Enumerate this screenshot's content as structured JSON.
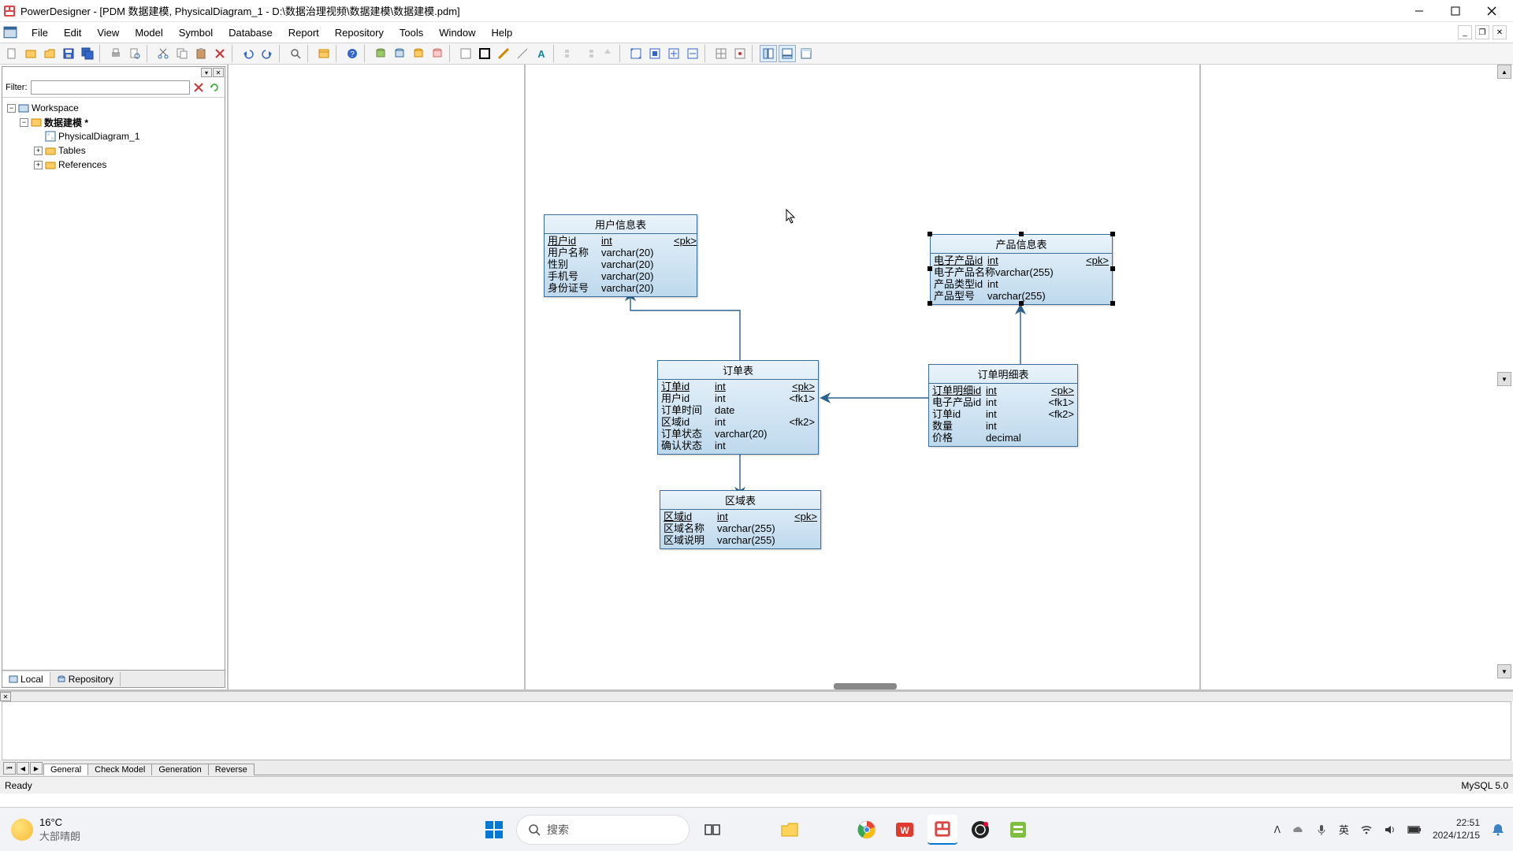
{
  "title": "PowerDesigner - [PDM 数据建模, PhysicalDiagram_1 - D:\\数据治理视频\\数据建模\\数据建模.pdm]",
  "menu": [
    "File",
    "Edit",
    "View",
    "Model",
    "Symbol",
    "Database",
    "Report",
    "Repository",
    "Tools",
    "Window",
    "Help"
  ],
  "sidebar": {
    "filter_label": "Filter:",
    "filter_value": "",
    "tree": {
      "root": "Workspace",
      "model": "数据建模 *",
      "diagram": "PhysicalDiagram_1",
      "tables": "Tables",
      "references": "References"
    },
    "tabs": [
      "Local",
      "Repository"
    ]
  },
  "entities": {
    "user": {
      "title": "用户信息表",
      "cols": [
        {
          "n": "用户id",
          "t": "int",
          "k": "<pk>",
          "u": true
        },
        {
          "n": "用户名称",
          "t": "varchar(20)",
          "k": ""
        },
        {
          "n": "性别",
          "t": "varchar(20)",
          "k": ""
        },
        {
          "n": "手机号",
          "t": "varchar(20)",
          "k": ""
        },
        {
          "n": "身份证号",
          "t": "varchar(20)",
          "k": ""
        }
      ]
    },
    "product": {
      "title": "产品信息表",
      "cols": [
        {
          "n": "电子产品id",
          "t": "int",
          "k": "<pk>",
          "u": true
        },
        {
          "n": "电子产品名称",
          "t": "varchar(255)",
          "k": ""
        },
        {
          "n": "产品类型id",
          "t": "int",
          "k": ""
        },
        {
          "n": "产品型号",
          "t": "varchar(255)",
          "k": ""
        }
      ]
    },
    "order": {
      "title": "订单表",
      "cols": [
        {
          "n": "订单id",
          "t": "int",
          "k": "<pk>",
          "u": true
        },
        {
          "n": "用户id",
          "t": "int",
          "k": "<fk1>"
        },
        {
          "n": "订单时间",
          "t": "date",
          "k": ""
        },
        {
          "n": "区域id",
          "t": "int",
          "k": "<fk2>"
        },
        {
          "n": "订单状态",
          "t": "varchar(20)",
          "k": ""
        },
        {
          "n": "确认状态",
          "t": "int",
          "k": ""
        }
      ]
    },
    "orderdetail": {
      "title": "订单明细表",
      "cols": [
        {
          "n": "订单明细id",
          "t": "int",
          "k": "<pk>",
          "u": true
        },
        {
          "n": "电子产品id",
          "t": "int",
          "k": "<fk1>"
        },
        {
          "n": "订单id",
          "t": "int",
          "k": "<fk2>"
        },
        {
          "n": "数量",
          "t": "int",
          "k": ""
        },
        {
          "n": "价格",
          "t": "decimal",
          "k": ""
        }
      ]
    },
    "region": {
      "title": "区域表",
      "cols": [
        {
          "n": "区域id",
          "t": "int",
          "k": "<pk>",
          "u": true
        },
        {
          "n": "区域名称",
          "t": "varchar(255)",
          "k": ""
        },
        {
          "n": "区域说明",
          "t": "varchar(255)",
          "k": ""
        }
      ]
    }
  },
  "output_tabs": [
    "General",
    "Check Model",
    "Generation",
    "Reverse"
  ],
  "status": {
    "left": "Ready",
    "right": "MySQL 5.0"
  },
  "taskbar": {
    "weather_temp": "16°C",
    "weather_desc": "大部晴朗",
    "search_placeholder": "搜索",
    "ime": "英",
    "time": "22:51",
    "date": "2024/12/15"
  }
}
